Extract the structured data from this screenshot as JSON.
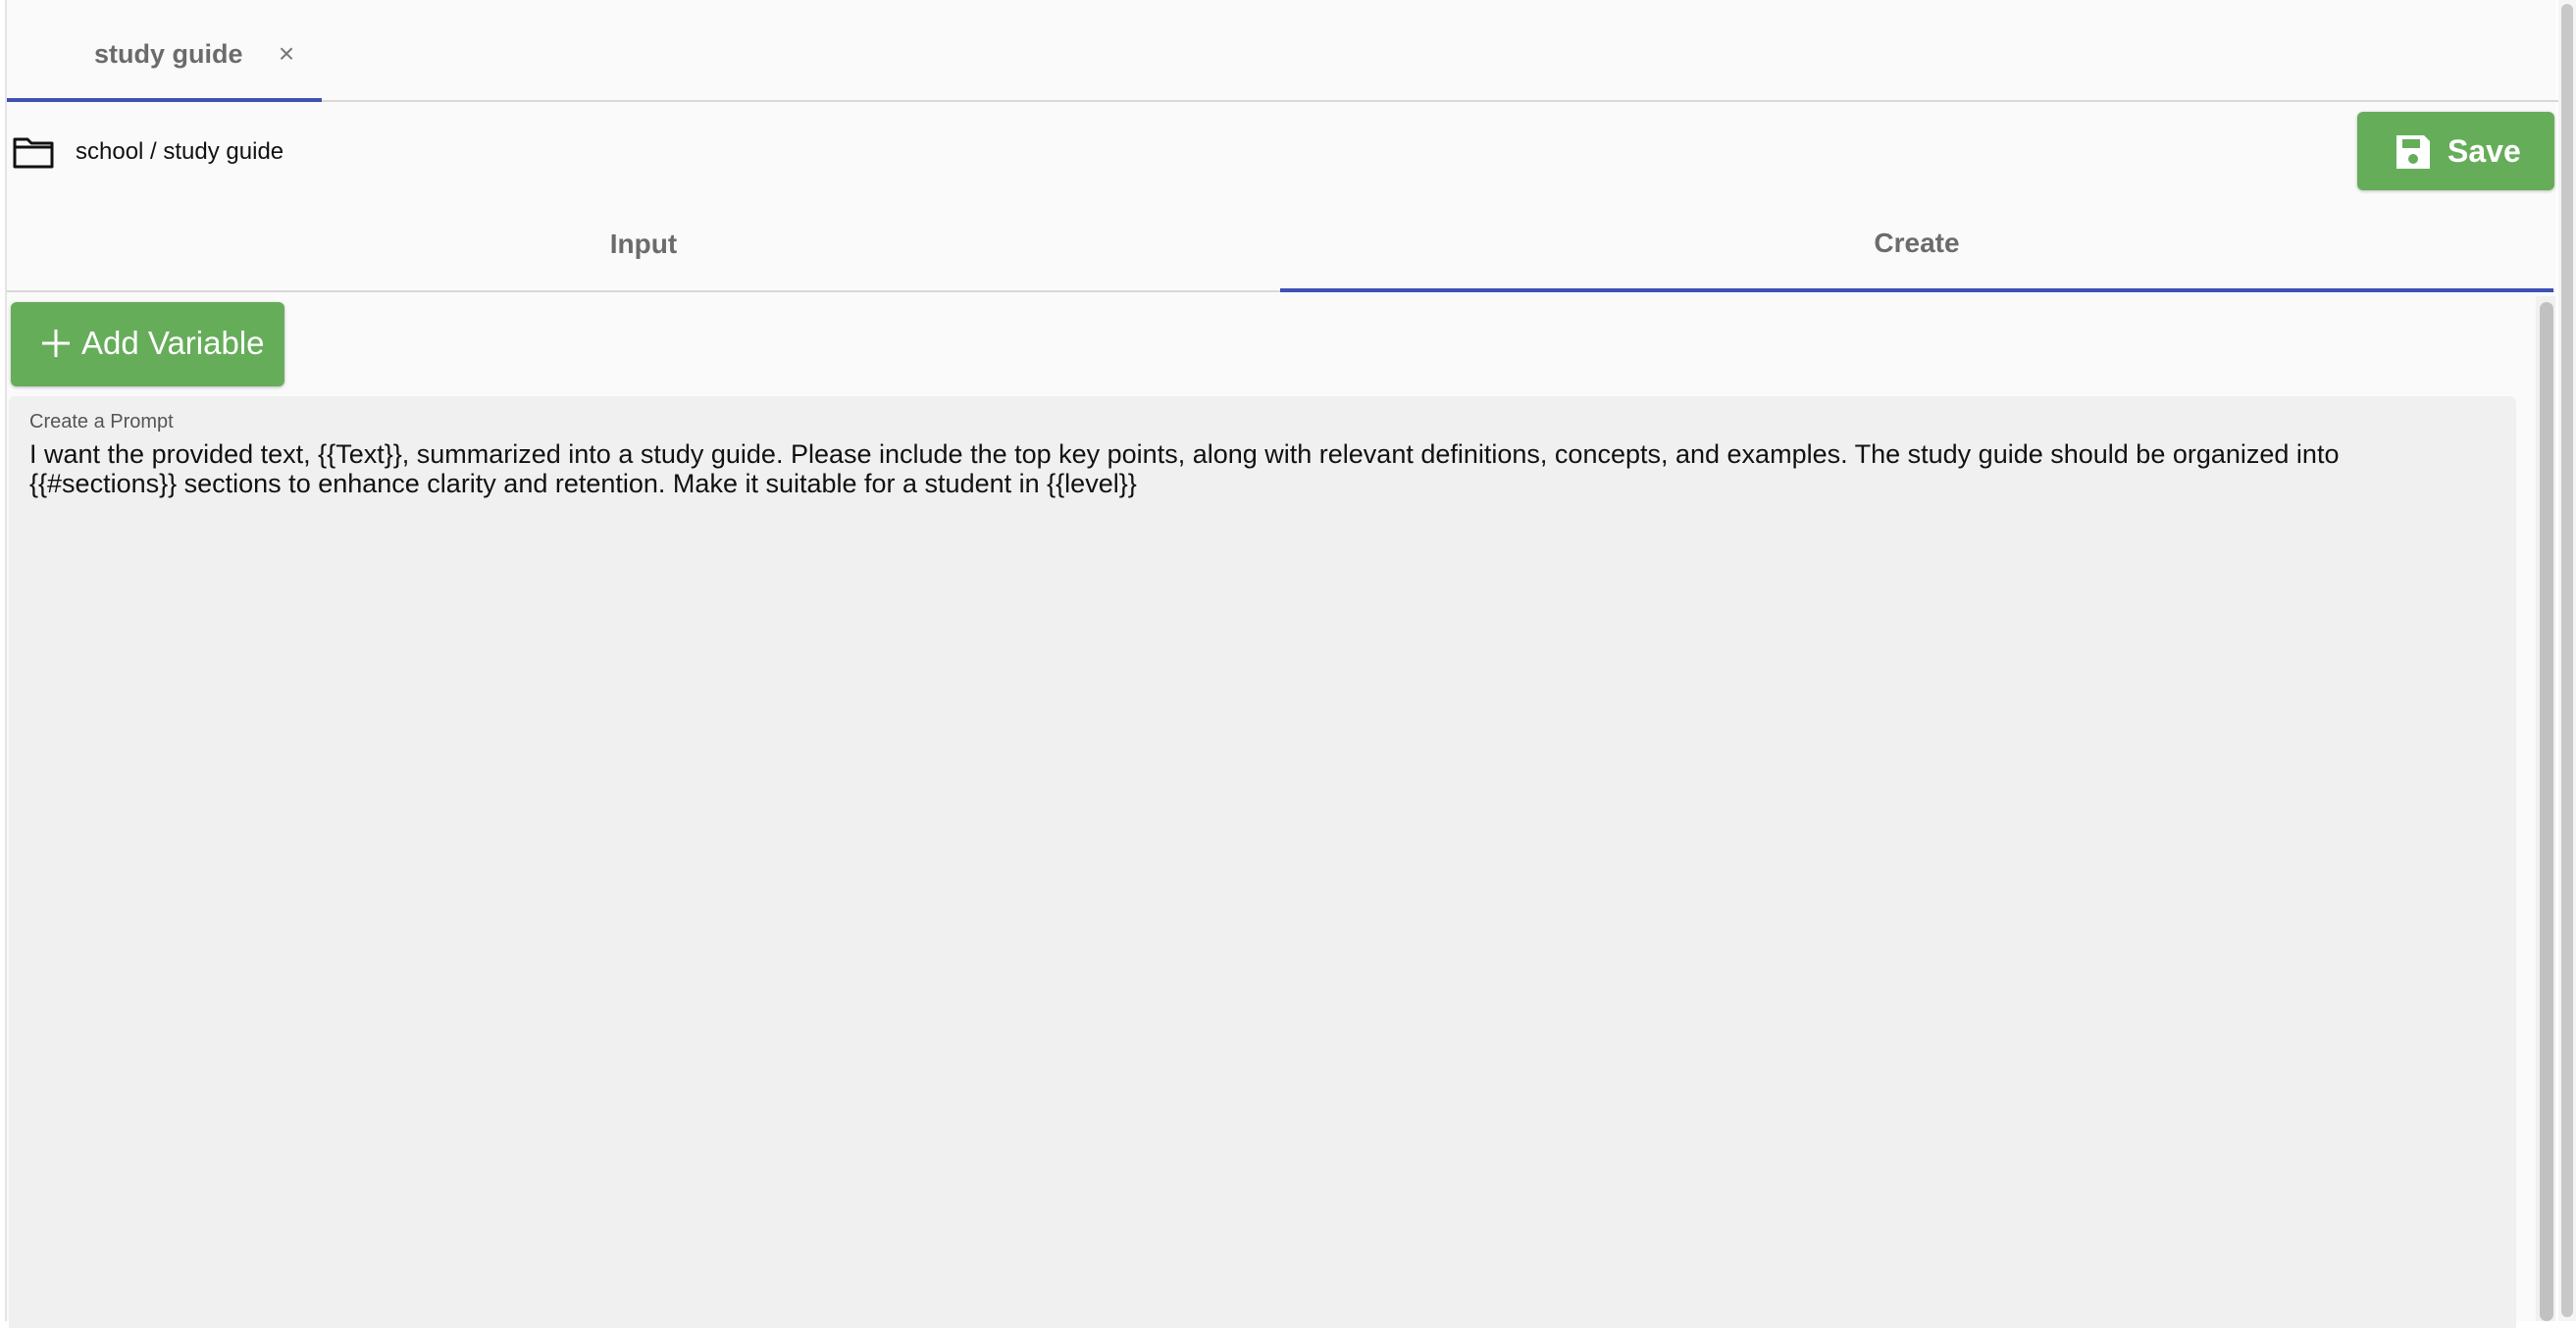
{
  "doc_tabs": [
    {
      "label": "study guide",
      "close_symbol": "×"
    }
  ],
  "path": {
    "icon": "folder-icon",
    "text": "school / study guide"
  },
  "save_button": {
    "icon": "floppy-disk-icon",
    "label": "Save"
  },
  "mode_tabs": {
    "input": "Input",
    "create": "Create",
    "active": "Create"
  },
  "add_variable": {
    "icon": "plus-icon",
    "label": "Add Variable"
  },
  "prompt": {
    "label": "Create a Prompt",
    "value": "I want the provided text, {{Text}}, summarized into a study guide. Please include the top key points, along with relevant definitions, concepts, and examples. The study guide should be organized into {{#sections}} sections to enhance clarity and retention. Make it suitable for a student in {{level}}"
  },
  "colors": {
    "accent": "#3f51b5",
    "button_green": "#66ad5a",
    "background": "#fafafa",
    "prompt_background": "#f0f0f0"
  }
}
